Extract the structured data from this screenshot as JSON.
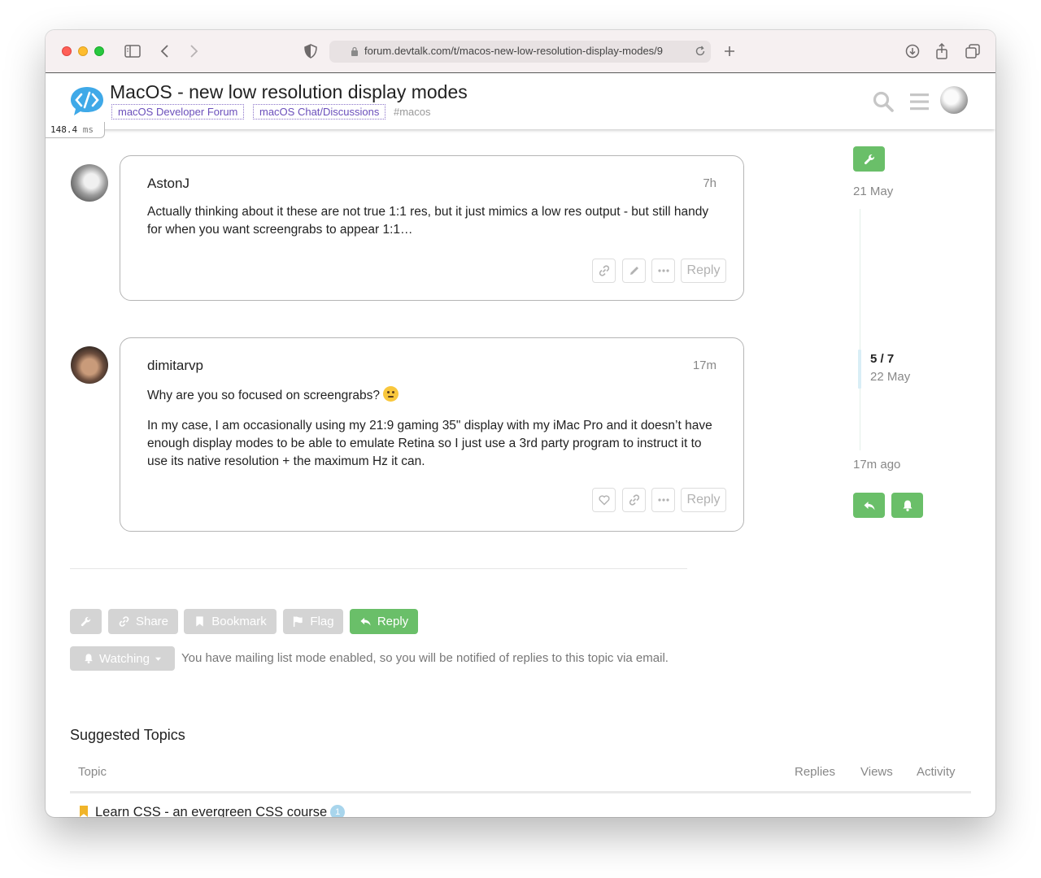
{
  "browser": {
    "url": "forum.devtalk.com/t/macos-new-low-resolution-display-modes/9"
  },
  "header": {
    "title": "MacOS - new low resolution display modes",
    "categories": [
      "macOS Developer Forum",
      "macOS Chat/Discussions"
    ],
    "tag": "#macos",
    "timing": "148.4",
    "timing_unit": "ms"
  },
  "posts": [
    {
      "username": "AstonJ",
      "time": "7h",
      "paragraphs": [
        "Actually thinking about it these are not true 1:1 res, but it just mimics a low res output - but still handy for when you want screengrabs to appear 1:1…"
      ],
      "reply_label": "Reply"
    },
    {
      "username": "dimitarvp",
      "time": "17m",
      "paragraphs": [
        "Why are you so focused on screengrabs?",
        "In my case, I am occasionally using my 21:9 gaming 35\" display with my iMac Pro and it doesn’t have enough display modes to be able to emulate Retina so I just use a 3rd party program to instruct it to use its native resolution + the maximum Hz it can."
      ],
      "reply_label": "Reply"
    }
  ],
  "timeline": {
    "start_date": "21 May",
    "position": "5 / 7",
    "position_date": "22 May",
    "end_label": "17m ago"
  },
  "footer": {
    "share_label": "Share",
    "bookmark_label": "Bookmark",
    "flag_label": "Flag",
    "reply_label": "Reply",
    "watching_label": "Watching",
    "notice": "You have mailing list mode enabled, so you will be notified of replies to this topic via email."
  },
  "suggested": {
    "title": "Suggested Topics",
    "columns": [
      "Topic",
      "Replies",
      "Views",
      "Activity"
    ],
    "rows": [
      {
        "title": "Learn CSS - an evergreen CSS course",
        "badge": "1"
      }
    ]
  },
  "colors": {
    "accent_green": "#6abf69",
    "category": "#6b4fbb"
  }
}
